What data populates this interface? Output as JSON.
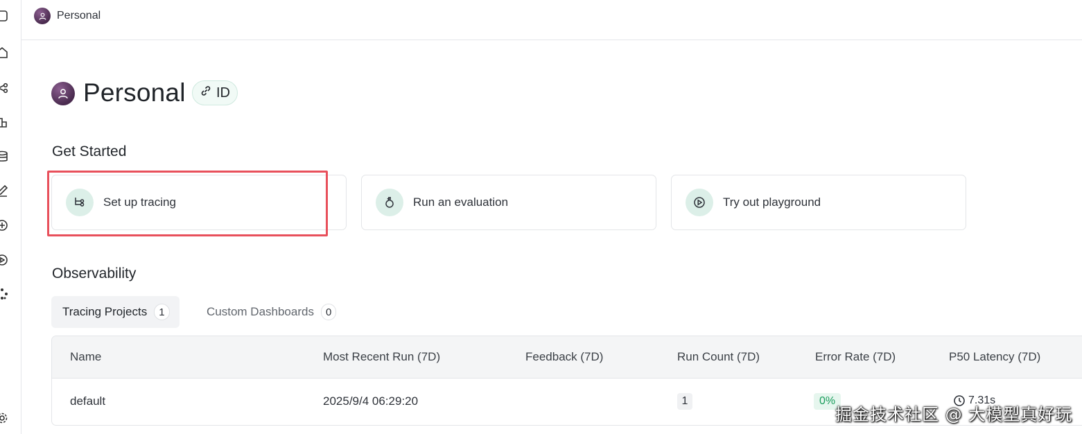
{
  "topbar": {
    "workspace_name": "Personal",
    "avatar_icon": "user-icon"
  },
  "header": {
    "title": "Personal",
    "id_badge_label": "ID",
    "id_badge_icon": "link-icon"
  },
  "get_started": {
    "title": "Get Started",
    "cards": [
      {
        "label": "Set up tracing",
        "icon": "tracing-icon"
      },
      {
        "label": "Run an evaluation",
        "icon": "flask-icon"
      },
      {
        "label": "Try out playground",
        "icon": "play-circle-icon"
      }
    ]
  },
  "observability": {
    "title": "Observability",
    "tabs": [
      {
        "label": "Tracing Projects",
        "count": "1",
        "active": true
      },
      {
        "label": "Custom Dashboards",
        "count": "0",
        "active": false
      }
    ],
    "table": {
      "columns": [
        "Name",
        "Most Recent Run (7D)",
        "Feedback (7D)",
        "Run Count (7D)",
        "Error Rate (7D)",
        "P50 Latency (7D)"
      ],
      "rows": [
        {
          "name": "default",
          "most_recent_run": "2025/9/4 06:29:20",
          "feedback": "",
          "run_count": "1",
          "error_rate": "0%",
          "p50_latency": "7.31s"
        }
      ]
    }
  },
  "sidebar": {
    "icons": [
      "panel-icon",
      "home-icon",
      "share-icon",
      "dashboard-icon",
      "database-icon",
      "edit-icon",
      "add-circle-icon",
      "play-icon",
      "graph-icon",
      "settings-icon"
    ]
  },
  "watermark": "掘金技术社区 @ 大模型真好玩",
  "colors": {
    "accent_bg": "#dcefe8",
    "highlight_border": "#e8505b",
    "success_text": "#1a9d5c"
  }
}
